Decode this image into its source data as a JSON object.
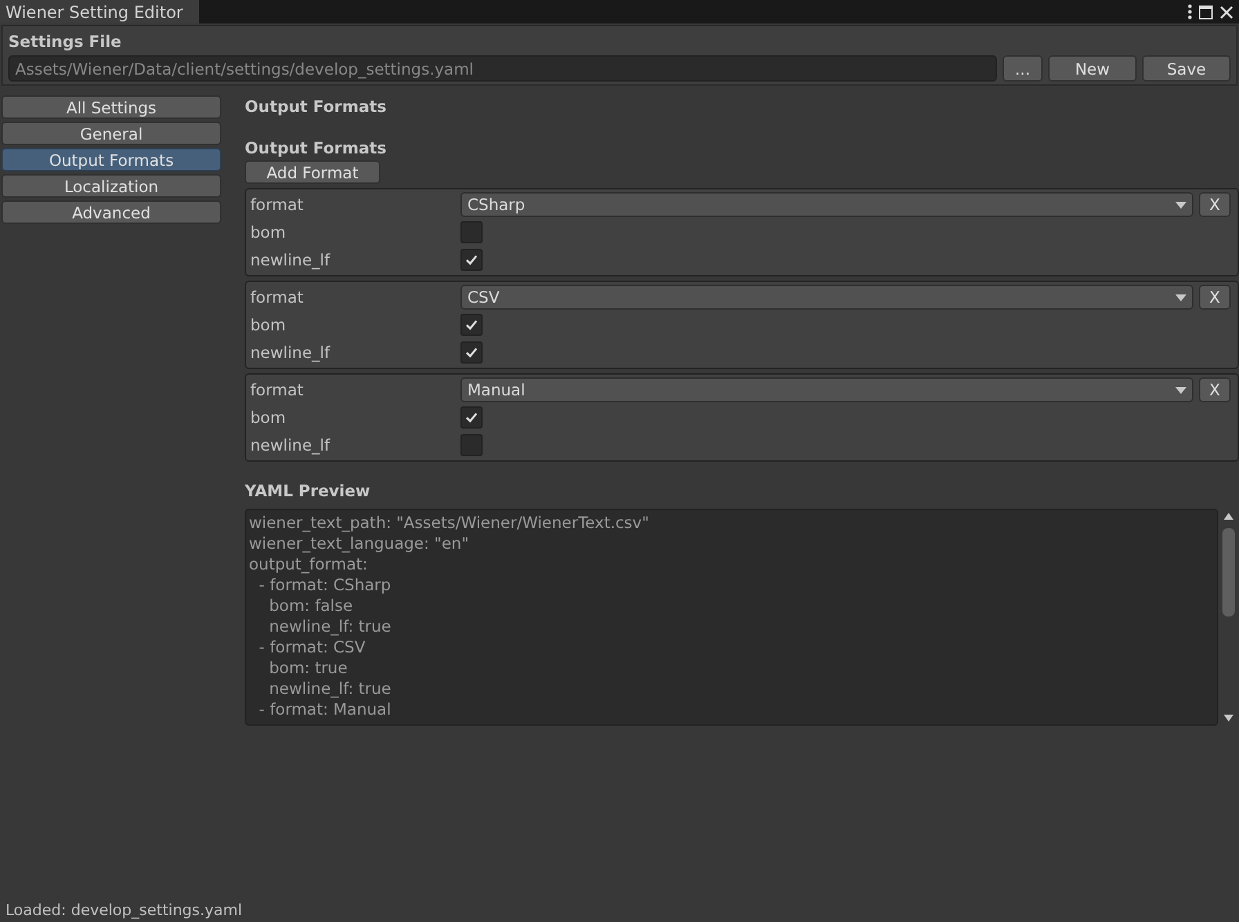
{
  "window": {
    "title": "Wiener Setting Editor"
  },
  "settings_file": {
    "label": "Settings File",
    "path": "Assets/Wiener/Data/client/settings/develop_settings.yaml",
    "buttons": [
      "...",
      "New",
      "Save"
    ]
  },
  "sidebar": {
    "items": [
      {
        "label": "All Settings",
        "selected": false
      },
      {
        "label": "General",
        "selected": false
      },
      {
        "label": "Output Formats",
        "selected": true
      },
      {
        "label": "Localization",
        "selected": false
      },
      {
        "label": "Advanced",
        "selected": false
      }
    ]
  },
  "main": {
    "page_title": "Output Formats",
    "section_title": "Output Formats",
    "add_button": "Add Format",
    "formats": [
      {
        "format_label": "format",
        "format": "CSharp",
        "remove": "X",
        "bom_label": "bom",
        "bom": false,
        "newline_label": "newline_lf",
        "newline_lf": true
      },
      {
        "format_label": "format",
        "format": "CSV",
        "remove": "X",
        "bom_label": "bom",
        "bom": true,
        "newline_label": "newline_lf",
        "newline_lf": true
      },
      {
        "format_label": "format",
        "format": "Manual",
        "remove": "X",
        "bom_label": "bom",
        "bom": true,
        "newline_label": "newline_lf",
        "newline_lf": false
      }
    ],
    "yaml_title": "YAML Preview",
    "yaml_lines": [
      "wiener_text_path: \"Assets/Wiener/WienerText.csv\"",
      "wiener_text_language: \"en\"",
      "output_format:",
      "  - format: CSharp",
      "    bom: false",
      "    newline_lf: true",
      "  - format: CSV",
      "    bom: true",
      "    newline_lf: true",
      "  - format: Manual"
    ]
  },
  "status_bar": {
    "text": "Loaded: develop_settings.yaml"
  }
}
